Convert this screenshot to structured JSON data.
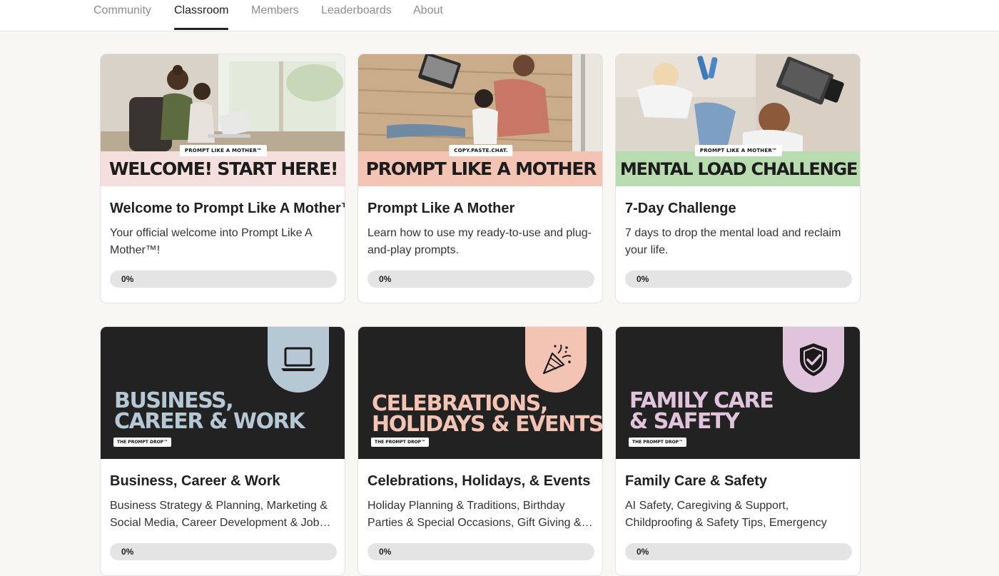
{
  "nav": {
    "tabs": [
      {
        "label": "Community",
        "active": false
      },
      {
        "label": "Classroom",
        "active": true
      },
      {
        "label": "Members",
        "active": false
      },
      {
        "label": "Leaderboards",
        "active": false
      },
      {
        "label": "About",
        "active": false
      }
    ]
  },
  "courses": [
    {
      "banner": {
        "style": "photo",
        "brand": "PROMPT LIKE A MOTHER™",
        "headline": "WELCOME! START HERE!",
        "accent": "#f5dfdc"
      },
      "title": "Welcome to Prompt Like A Mother™",
      "description": "Your official welcome into Prompt Like A Mother™!",
      "progress": 0,
      "progress_label": "0%"
    },
    {
      "banner": {
        "style": "photo",
        "brand": "COPY.PASTE.CHAT.",
        "headline": "PROMPT LIKE A MOTHER",
        "accent": "#f3c3b3"
      },
      "title": "Prompt Like A Mother",
      "description": "Learn how to use my ready-to-use and plug-and-play prompts.",
      "progress": 0,
      "progress_label": "0%"
    },
    {
      "banner": {
        "style": "photo",
        "brand": "PROMPT LIKE A MOTHER™",
        "headline": "MENTAL LOAD CHALLENGE",
        "accent": "#b8dcb0"
      },
      "title": "7-Day Challenge",
      "description": "7 days to drop the mental load and reclaim your life.",
      "progress": 0,
      "progress_label": "0%"
    },
    {
      "banner": {
        "style": "dark",
        "brand": "THE PROMPT DROP™",
        "headline_line1": "BUSINESS,",
        "headline_line2": "CAREER & WORK",
        "accent": "#b5c8d4",
        "icon": "laptop-icon"
      },
      "title": "Business, Career & Work",
      "description": "Business Strategy & Planning, Marketing & Social Media, Career Development & Job…",
      "progress": 0,
      "progress_label": "0%"
    },
    {
      "banner": {
        "style": "dark",
        "brand": "THE PROMPT DROP™",
        "headline_line1": "CELEBRATIONS,",
        "headline_line2": "HOLIDAYS & EVENTS",
        "accent": "#f3c3b3",
        "icon": "party-popper-icon"
      },
      "title": "Celebrations, Holidays, & Events",
      "description": "Holiday Planning & Traditions, Birthday Parties & Special Occasions, Gift Giving &…",
      "progress": 0,
      "progress_label": "0%"
    },
    {
      "banner": {
        "style": "dark",
        "brand": "THE PROMPT DROP™",
        "headline_line1": "FAMILY CARE",
        "headline_line2": "& SAFETY",
        "accent": "#e0c4dc",
        "icon": "shield-check-icon"
      },
      "title": "Family Care & Safety",
      "description": "AI Safety, Caregiving & Support, Childproofing & Safety Tips, Emergency Preparedness,…",
      "progress": 0,
      "progress_label": "0%"
    }
  ]
}
